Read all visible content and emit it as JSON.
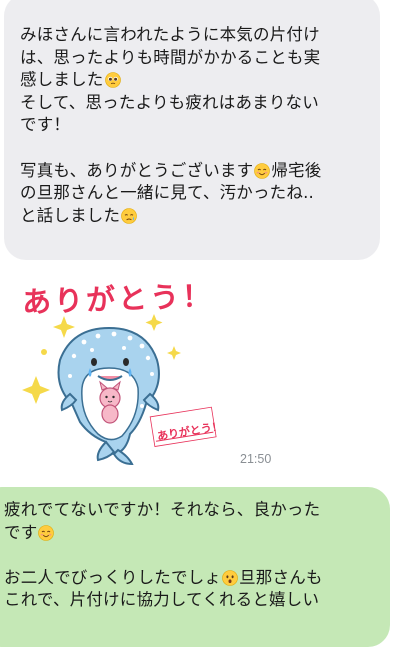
{
  "incoming_message": {
    "lines": [
      {
        "text": "みほさんに言われたように本気の片付け",
        "emoji": ""
      },
      {
        "text": "は、思ったよりも時間がかかることも実",
        "emoji": ""
      },
      {
        "text": "感しました",
        "emoji": "pleading-face-emoji"
      },
      {
        "text": "そして、思ったよりも疲れはあまりない",
        "emoji": ""
      },
      {
        "text": "です！",
        "emoji": ""
      },
      {
        "text": "",
        "emoji": ""
      },
      {
        "text": "写真も、ありがとうございます",
        "emoji": "smiling-face-emoji",
        "after": "帰宅後"
      },
      {
        "text": "の旦那さんと一緒に見て、汚かったね..",
        "emoji": ""
      },
      {
        "text": "と話しました",
        "emoji": "crying-face-emoji"
      }
    ]
  },
  "sticker": {
    "title": "ありがとう！",
    "card_text": "ありがとう！",
    "character": "whale-shark-character"
  },
  "timestamp": "21:50",
  "outgoing_message": {
    "lines": [
      {
        "text": "疲れでてないですか！それなら、良かった",
        "emoji": ""
      },
      {
        "text": "です",
        "emoji": "smiling-face-emoji"
      },
      {
        "text": "",
        "emoji": ""
      },
      {
        "text": "お二人でびっくりしたでしょ",
        "emoji": "hushed-face-emoji",
        "after": "旦那さんも"
      },
      {
        "text": "これで、片付けに協力してくれると嬉しい",
        "emoji": ""
      }
    ]
  },
  "colors": {
    "incoming_bubble": "#ededf0",
    "outgoing_bubble": "#c5e8b6",
    "sticker_accent": "#e8325a",
    "timestamp": "#8a8f94"
  }
}
